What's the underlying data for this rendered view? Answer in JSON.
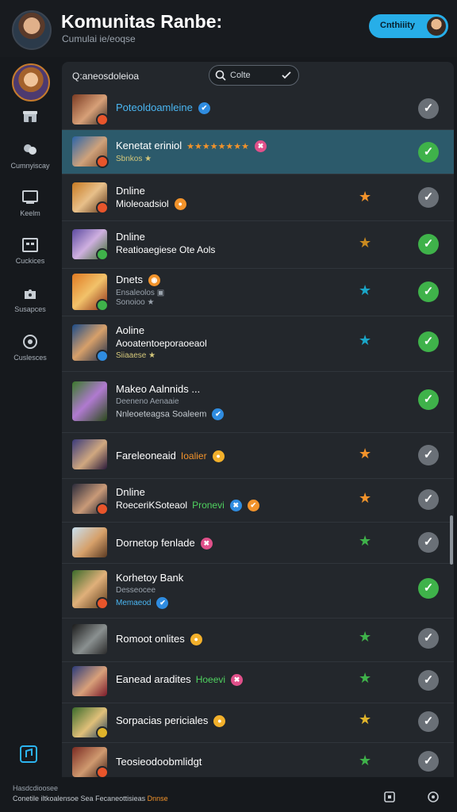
{
  "header": {
    "title": "Komunitas Ranbe:",
    "subtitle": "Cumulai ie/eoqse",
    "button_label": "Cnthiiity"
  },
  "sidebar": {
    "items": [
      {
        "label": "",
        "icon": "store-icon"
      },
      {
        "label": "Cumnyiscay",
        "icon": "community-icon"
      },
      {
        "label": "Keelm",
        "icon": "media-icon"
      },
      {
        "label": "Cuckices",
        "icon": "calendar-icon"
      },
      {
        "label": "Susapces",
        "icon": "puzzle-icon"
      },
      {
        "label": "Cuslesces",
        "icon": "support-icon"
      }
    ],
    "bottom_icon": "music-icon"
  },
  "panel": {
    "title": "Q:aneosdoleioa",
    "search_value": "Colte"
  },
  "rows": [
    {
      "line1": "Poteoldoamleine",
      "line1_color": "blue",
      "pill": "✔",
      "pill_color": "#2f8ce0",
      "star": "",
      "checked": false
    },
    {
      "line1": "Kenetat eriniol",
      "tag": "★★★★★★★★",
      "tag_color": "orange",
      "pill": "✖",
      "pill_color": "#e0508a",
      "line3": "Sbnkos ★",
      "star": "",
      "checked": true
    },
    {
      "line1": "Dnline",
      "line2": "Mioleoadsiol",
      "pill2": "●",
      "pill_color": "#f2932b",
      "star": "★",
      "star_color": "#f2932b",
      "checked": false
    },
    {
      "line1": "Dnline",
      "line2": "Reatioaegiese Ote Aols",
      "star": "★",
      "star_color": "#c98a20",
      "checked": true
    },
    {
      "line1": "Dnets",
      "pill": "◉",
      "pill_color": "#f2932b",
      "line3a": "Ensaleolos ▣",
      "line3": "Sonoioo ★",
      "star": "★",
      "star_color": "#1aa6c8",
      "checked": true
    },
    {
      "line1": "Aoline",
      "line2": "Aooatentoeporaoeaol",
      "line3": "Siiaaese ★",
      "star": "★",
      "star_color": "#1aa6c8",
      "checked": true
    },
    {
      "line1": "Makeo Aalnnids ...",
      "line3a": "Deeneno Aenaaie",
      "line3": "Nnleoeteagsa Soaleem",
      "pill3": "✔",
      "pill_color": "#2f8ce0",
      "star": "",
      "checked": true
    },
    {
      "line1": "Fareleoneaid",
      "tag": "Ioalier",
      "tag_color": "orange",
      "pill": "●",
      "pill_color": "#f2b02b",
      "star": "★",
      "star_color": "#f2932b",
      "checked": false
    },
    {
      "line1": "Dnline",
      "line2": "RoeceriKSoteaol",
      "tag": "Pronevi",
      "tag_color": "green",
      "pill": "✖",
      "pill_color": "#2f8ce0",
      "pill_b": "✔",
      "pill_b_color": "#f2932b",
      "star": "★",
      "star_color": "#f2932b",
      "checked": false
    },
    {
      "line1": "Dornetop fenlade",
      "pill": "✖",
      "pill_color": "#e0508a",
      "star": "★",
      "star_color": "#3fb24a",
      "checked": false
    },
    {
      "line1": "Korhetoy Bank",
      "line3a": "Desseocee",
      "line3": "Memaeod",
      "line3_color": "blue",
      "pill3": "✔",
      "pill_color": "#2f8ce0",
      "star": "",
      "checked": true
    },
    {
      "line1": "Romoot onlites",
      "pill": "●",
      "pill_color": "#f2b02b",
      "star": "★",
      "star_color": "#3fb24a",
      "checked": false
    },
    {
      "line1": "Eanead aradites",
      "tag": "Hoeevi",
      "tag_color": "green",
      "pill": "✖",
      "pill_color": "#e0508a",
      "star": "★",
      "star_color": "#3fb24a",
      "checked": false
    },
    {
      "line1": "Sorpacias periciales",
      "pill": "●",
      "pill_color": "#f2b02b",
      "star": "★",
      "star_color": "#e0b42b",
      "checked": false
    },
    {
      "line1": "Teosieodoobmlidgt",
      "star": "★",
      "star_color": "#3fb24a",
      "checked": false
    }
  ],
  "footer": {
    "line1": "Hasdcdioosee",
    "line2": "Conetile iltkoalensoe Sea Fecaneottisieas",
    "highlight": "Dnnse"
  },
  "colors": {
    "accent": "#27aee8",
    "selected_row": "#2c5a6b",
    "check_on": "#3fb24a",
    "check_off": "#6a7077",
    "background": "#16191d",
    "panel": "#23272c"
  }
}
